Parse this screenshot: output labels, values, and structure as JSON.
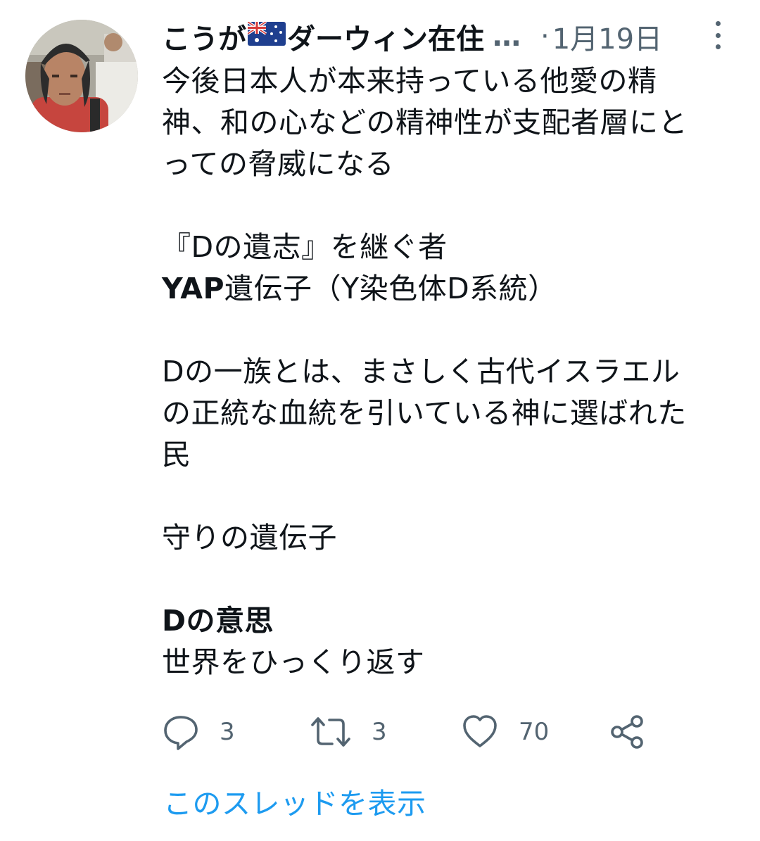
{
  "tweet": {
    "author_name_part1": "こうが",
    "author_flag": "australia-flag",
    "author_name_part2": "ダーウィン在住",
    "name_ellipsis": "…",
    "separator": "·",
    "date": "1月19日",
    "body": {
      "p1_line1": "今後日本人が本来持っている他愛の精",
      "p1_line2": "神、和の心などの精神性が支配者層にと",
      "p1_line3": "っての脅威になる",
      "p2_line1": "『Dの遺志』を継ぐ者",
      "p2_line2_bold": "YAP",
      "p2_line2_rest": "遺伝子（Y染色体D系統）",
      "p3_line1": "Dの一族とは、まさしく古代イスラエル",
      "p3_line2": "の正統な血統を引いている神に選ばれた",
      "p3_line3": "民",
      "p4_line1": "守りの遺伝子",
      "p5_line1_bold": "Dの意思",
      "p5_line2": "世界をひっくり返す"
    },
    "actions": {
      "reply_icon": "reply-icon",
      "reply_count": "3",
      "retweet_icon": "retweet-icon",
      "retweet_count": "3",
      "like_icon": "heart-icon",
      "like_count": "70",
      "share_icon": "share-icon"
    },
    "show_thread": "このスレッドを表示"
  },
  "colors": {
    "text": "#0f1419",
    "muted": "#536471",
    "link": "#1d9bf0"
  }
}
